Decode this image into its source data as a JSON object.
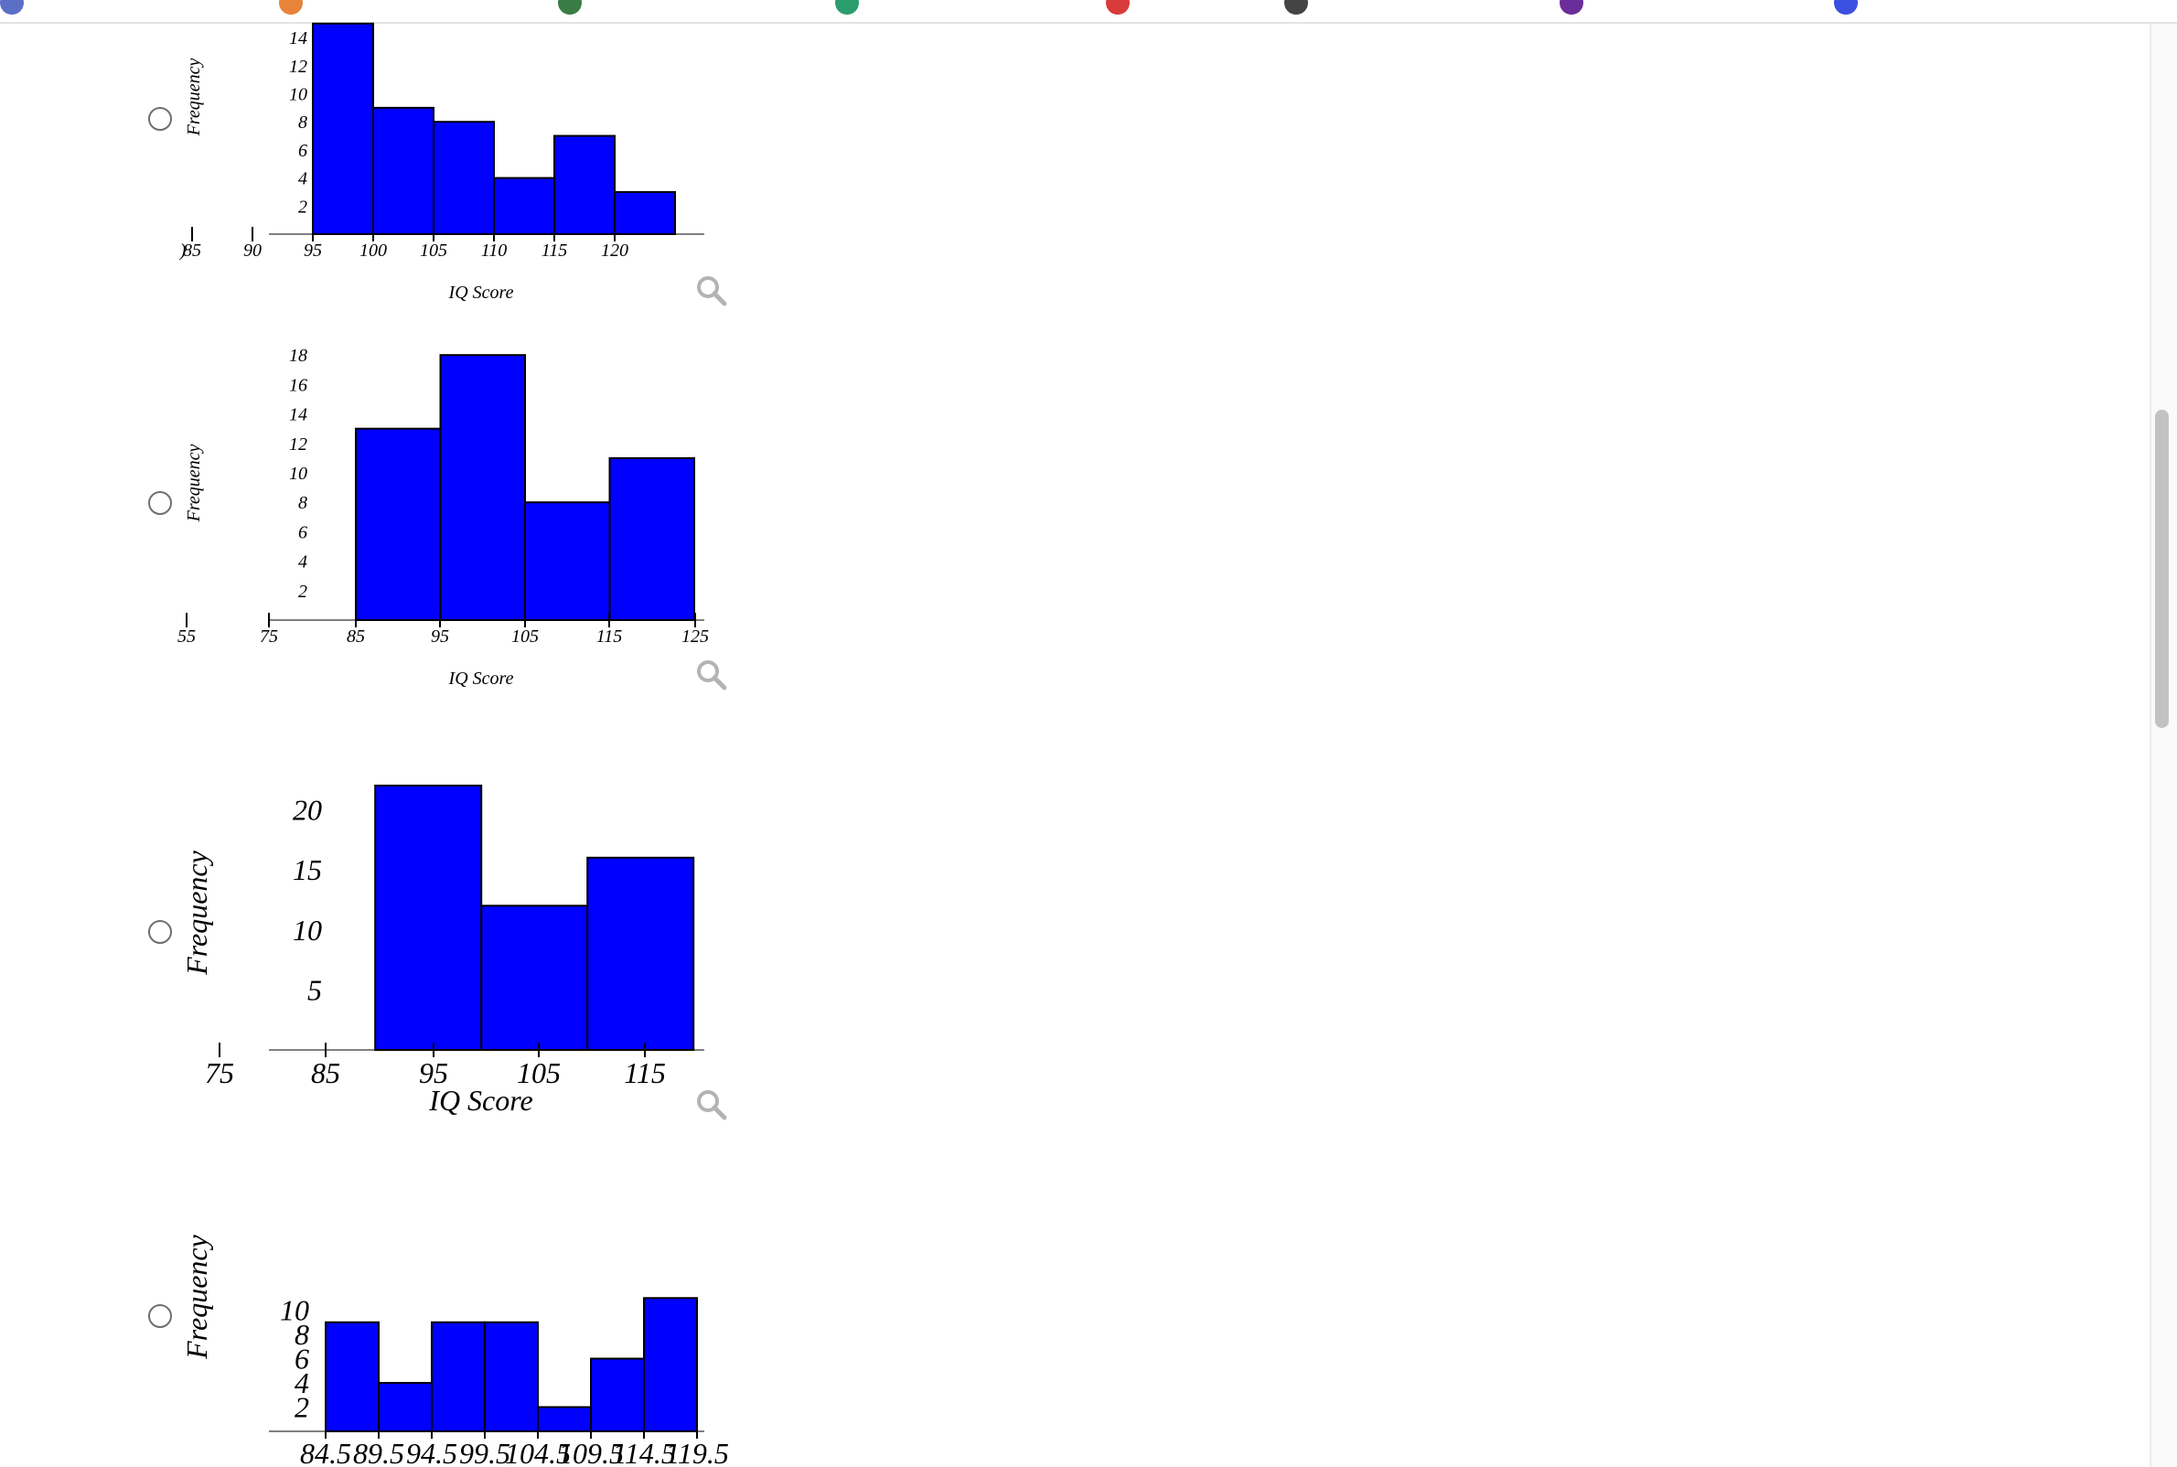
{
  "browser": {
    "bookmark_bar_icons": [
      {
        "name": "bookmark-icon-1",
        "color": "#5b6fc7"
      },
      {
        "name": "bookmark-icon-2",
        "color": "#e8833a"
      },
      {
        "name": "bookmark-icon-3",
        "color": "#3a7d44"
      },
      {
        "name": "bookmark-icon-4",
        "color": "#2a9d6f"
      },
      {
        "name": "bookmark-icon-5",
        "color": "#d93a3a"
      },
      {
        "name": "bookmark-icon-6",
        "color": "#444444"
      },
      {
        "name": "bookmark-icon-7",
        "color": "#6b2d9a"
      },
      {
        "name": "bookmark-icon-8",
        "color": "#3b4fe0"
      }
    ]
  },
  "question": {
    "options": [
      {
        "magnifier_icon": "magnifier-icon",
        "chart": {
          "type": "bar",
          "ylabel": "Frequency",
          "xlabel": "IQ Score",
          "bar_color": "#0000ff",
          "x_ticks": [
            "85",
            "90",
            "95",
            "100",
            "105",
            "110",
            "115",
            "120"
          ],
          "y_ticks": [
            "2",
            "4",
            "6",
            "8",
            "10",
            "12",
            "14"
          ],
          "cut_off_label": ")",
          "bins": [
            [
              95,
              100
            ],
            [
              100,
              105
            ],
            [
              105,
              110
            ],
            [
              110,
              115
            ],
            [
              115,
              120
            ],
            [
              120,
              125
            ]
          ],
          "values": [
            15,
            9,
            8,
            4,
            7,
            3
          ]
        }
      },
      {
        "magnifier_icon": "magnifier-icon",
        "chart": {
          "type": "bar",
          "ylabel": "Frequency",
          "xlabel": "IQ Score",
          "bar_color": "#0000ff",
          "x_ticks": [
            "55",
            "75",
            "85",
            "95",
            "105",
            "115",
            "125"
          ],
          "y_ticks": [
            "2",
            "4",
            "6",
            "8",
            "10",
            "12",
            "14",
            "16",
            "18"
          ],
          "bins": [
            [
              85,
              95
            ],
            [
              95,
              105
            ],
            [
              105,
              115
            ],
            [
              115,
              125
            ]
          ],
          "values": [
            13,
            18,
            8,
            11
          ]
        }
      },
      {
        "magnifier_icon": "magnifier-icon",
        "chart": {
          "type": "bar",
          "ylabel": "Frequency",
          "xlabel": "IQ Score",
          "bar_color": "#0000ff",
          "x_ticks": [
            "75",
            "85",
            "95",
            "105",
            "115"
          ],
          "y_ticks": [
            "5",
            "10",
            "15",
            "20"
          ],
          "bins": [
            [
              89.5,
              99.5
            ],
            [
              99.5,
              109.5
            ],
            [
              109.5,
              119.5
            ]
          ],
          "values": [
            22,
            12,
            16
          ]
        }
      },
      {
        "chart": {
          "type": "bar",
          "ylabel": "Frequency",
          "xlabel": "",
          "bar_color": "#0000ff",
          "x_ticks": [
            "84.5",
            "89.5",
            "94.5",
            "99.5",
            "104.5",
            "109.5",
            "114.5",
            "119.5"
          ],
          "y_ticks": [
            "2",
            "4",
            "6",
            "8",
            "10"
          ],
          "bins": [
            [
              84.5,
              89.5
            ],
            [
              89.5,
              94.5
            ],
            [
              94.5,
              99.5
            ],
            [
              99.5,
              104.5
            ],
            [
              104.5,
              109.5
            ],
            [
              109.5,
              114.5
            ],
            [
              114.5,
              119.5
            ]
          ],
          "values": [
            9,
            4,
            9,
            9,
            2,
            6,
            11
          ]
        }
      }
    ]
  }
}
